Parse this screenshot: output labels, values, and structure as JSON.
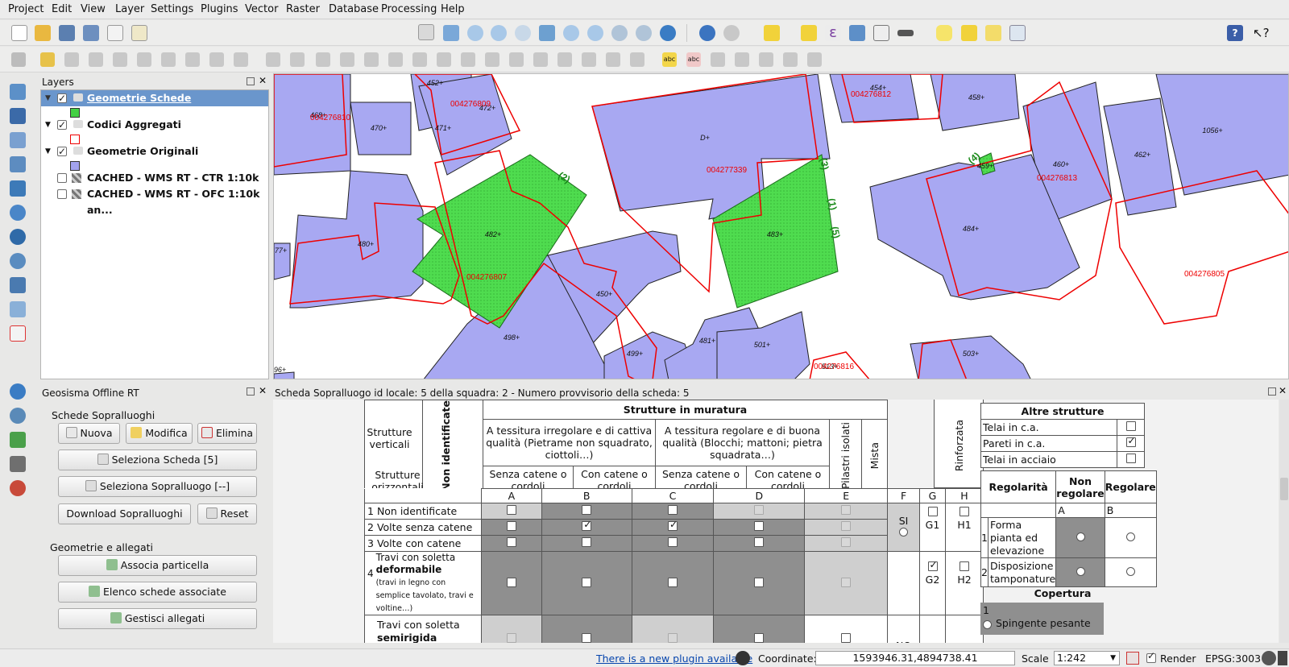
{
  "menu": [
    "Project",
    "Edit",
    "View",
    "Layer",
    "Settings",
    "Plugins",
    "Vector",
    "Raster",
    "Database",
    "Processing",
    "Help"
  ],
  "layers_panel": {
    "title": "Layers",
    "items": [
      {
        "label": "Geometrie Schede",
        "checked": true,
        "selected": true
      },
      {
        "label": "Codici Aggregati",
        "checked": true
      },
      {
        "label": "Geometrie Originali",
        "checked": true
      },
      {
        "label": "CACHED - WMS RT - CTR 1:10k",
        "checked": false
      },
      {
        "label": "CACHED - WMS RT - OFC 1:10k an...",
        "checked": false
      }
    ]
  },
  "map": {
    "codes": [
      "004276809",
      "004276810",
      "004276812",
      "004277339",
      "004276813",
      "004276807",
      "004276805",
      "004276816"
    ],
    "parcels": [
      "452+",
      "454+",
      "458+",
      "471+",
      "472+",
      "470+",
      "468+",
      "D+",
      "460+",
      "462+",
      "1056+",
      "459+",
      "482+",
      "483+",
      "484+",
      "480+",
      "477+",
      "450+",
      "498+",
      "499+",
      "481+",
      "501+",
      "503+",
      "496+",
      "513+"
    ],
    "annotations": [
      "(2)",
      "(3)",
      "(1)",
      "(5)",
      "(4)"
    ]
  },
  "geo_panel": {
    "title": "Geosisma Offline RT",
    "section1": "Schede Sopralluoghi",
    "btn_nuova": "Nuova",
    "btn_modifica": "Modifica",
    "btn_elimina": "Elimina",
    "btn_seleziona_scheda": "Seleziona Scheda [5]",
    "btn_seleziona_sopralluogo": "Seleziona Sopralluogo [--]",
    "btn_download": "Download Sopralluoghi",
    "btn_reset": "Reset",
    "section2": "Geometrie e allegati",
    "btn_associa": "Associa particella",
    "btn_elenco": "Elenco schede associate",
    "btn_gestisci": "Gestisci allegati"
  },
  "form": {
    "title": "Scheda Sopralluogo id locale: 5 della squadra: 2 - Numero provvisorio della scheda: 5",
    "strutture_verticali": "Strutture verticali",
    "strutture_orizzontali": "Strutture orizzontali",
    "non_identificate": "Non identificate",
    "strutture_muratura": "Strutture in muratura",
    "irregolare": "A tessitura irregolare e di cattiva qualità (Pietrame non squadrato, ciottoli…)",
    "regolare": "A tessitura regolare e di buona qualità (Blocchi; mattoni; pietra squadrata…)",
    "senza_catene": "Senza catene o cordoli",
    "con_catene": "Con catene o cordoli",
    "pilastri": "Pilastri isolati",
    "mista": "Mista",
    "rinforzata": "Rinforzata",
    "col_letters": [
      "A",
      "B",
      "C",
      "D",
      "E",
      "F",
      "G",
      "H"
    ],
    "rows": [
      {
        "n": "1",
        "label": "Non identificate"
      },
      {
        "n": "2",
        "label": "Volte senza catene"
      },
      {
        "n": "3",
        "label": "Volte con catene"
      },
      {
        "n": "4",
        "label": "Travi con soletta",
        "bold": "deformabile",
        "small": "(travi in legno con semplice tavolato, travi e voltine…)"
      },
      {
        "n": "5",
        "label": "Travi con soletta",
        "bold": "semirigida"
      }
    ],
    "si": "SI",
    "no": "NO",
    "g1": "G1",
    "h1": "H1",
    "g2": "G2",
    "h2": "H2",
    "altre_strutture": "Altre strutture",
    "altre": [
      {
        "label": "Telai in c.a.",
        "checked": false
      },
      {
        "label": "Pareti in c.a.",
        "checked": true
      },
      {
        "label": "Telai in acciaio",
        "checked": false
      }
    ],
    "regolarita": "Regolarità",
    "non_regolare": "Non regolare",
    "regolare_col": "Regolare",
    "reg_rows": [
      {
        "n": "1",
        "label": "Forma pianta ed elevazione"
      },
      {
        "n": "2",
        "label": "Disposizione tamponature"
      }
    ],
    "copertura": "Copertura",
    "cop_n": "1",
    "spingente": "Spingente pesante"
  },
  "status": {
    "plugin_link": "There is a new plugin available",
    "coord_label": "Coordinate:",
    "coord_value": "1593946.31,4894738.41",
    "scale_label": "Scale",
    "scale_value": "1:242",
    "render_label": "Render",
    "epsg": "EPSG:3003"
  }
}
